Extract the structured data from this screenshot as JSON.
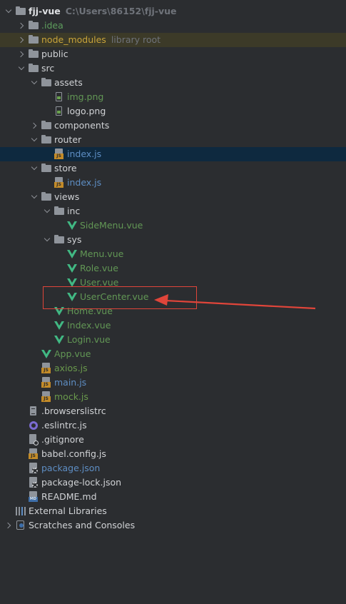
{
  "project": {
    "name": "fjj-vue",
    "path": "C:\\Users\\86152\\fjj-vue"
  },
  "tree": [
    {
      "label": "fjj-vue",
      "hint": "C:\\Users\\86152\\fjj-vue",
      "icon": "folder-icon",
      "depth": 0,
      "arrow": "open",
      "color": "bold"
    },
    {
      "label": ".idea",
      "icon": "folder-icon",
      "depth": 1,
      "arrow": "closed",
      "color": "idea"
    },
    {
      "label": "node_modules",
      "hint": "library root",
      "icon": "folder-icon",
      "depth": 1,
      "arrow": "closed",
      "color": "nm",
      "row": "hl-nm"
    },
    {
      "label": "public",
      "icon": "folder-icon",
      "depth": 1,
      "arrow": "closed",
      "color": "white"
    },
    {
      "label": "src",
      "icon": "folder-icon",
      "depth": 1,
      "arrow": "open",
      "color": "white"
    },
    {
      "label": "assets",
      "icon": "folder-icon",
      "depth": 2,
      "arrow": "open",
      "color": "white"
    },
    {
      "label": "img.png",
      "icon": "image-file-icon",
      "depth": 3,
      "color": "green"
    },
    {
      "label": "logo.png",
      "icon": "image-file-icon",
      "depth": 3,
      "color": "white"
    },
    {
      "label": "components",
      "icon": "folder-icon",
      "depth": 2,
      "arrow": "closed",
      "color": "white"
    },
    {
      "label": "router",
      "icon": "folder-icon",
      "depth": 2,
      "arrow": "open",
      "color": "white"
    },
    {
      "label": "index.js",
      "icon": "js-file-icon",
      "depth": 3,
      "color": "blue",
      "row": "sel"
    },
    {
      "label": "store",
      "icon": "folder-icon",
      "depth": 2,
      "arrow": "open",
      "color": "white"
    },
    {
      "label": "index.js",
      "icon": "js-file-icon",
      "depth": 3,
      "color": "blue"
    },
    {
      "label": "views",
      "icon": "folder-icon",
      "depth": 2,
      "arrow": "open",
      "color": "white"
    },
    {
      "label": "inc",
      "icon": "folder-icon",
      "depth": 3,
      "arrow": "open",
      "color": "white"
    },
    {
      "label": "SideMenu.vue",
      "icon": "vue-file-icon",
      "depth": 4,
      "color": "green"
    },
    {
      "label": "sys",
      "icon": "folder-icon",
      "depth": 3,
      "arrow": "open",
      "color": "white"
    },
    {
      "label": "Menu.vue",
      "icon": "vue-file-icon",
      "depth": 4,
      "color": "green"
    },
    {
      "label": "Role.vue",
      "icon": "vue-file-icon",
      "depth": 4,
      "color": "green"
    },
    {
      "label": "User.vue",
      "icon": "vue-file-icon",
      "depth": 4,
      "color": "green"
    },
    {
      "label": "UserCenter.vue",
      "icon": "vue-file-icon",
      "depth": 4,
      "color": "green"
    },
    {
      "label": "Home.vue",
      "icon": "vue-file-icon",
      "depth": 3,
      "color": "green"
    },
    {
      "label": "Index.vue",
      "icon": "vue-file-icon",
      "depth": 3,
      "color": "green"
    },
    {
      "label": "Login.vue",
      "icon": "vue-file-icon",
      "depth": 3,
      "color": "green"
    },
    {
      "label": "App.vue",
      "icon": "vue-file-icon",
      "depth": 2,
      "color": "green"
    },
    {
      "label": "axios.js",
      "icon": "js-file-icon",
      "depth": 2,
      "color": "js"
    },
    {
      "label": "main.js",
      "icon": "js-file-icon",
      "depth": 2,
      "color": "blue"
    },
    {
      "label": "mock.js",
      "icon": "js-file-icon",
      "depth": 2,
      "color": "js"
    },
    {
      "label": ".browserslistrc",
      "icon": "text-file-icon",
      "depth": 1,
      "color": "white"
    },
    {
      "label": ".eslintrc.js",
      "icon": "eslint-icon",
      "depth": 1,
      "color": "white"
    },
    {
      "label": ".gitignore",
      "icon": "gitignore-icon",
      "depth": 1,
      "color": "white"
    },
    {
      "label": "babel.config.js",
      "icon": "js-file-icon",
      "depth": 1,
      "color": "white"
    },
    {
      "label": "package.json",
      "icon": "json-file-icon",
      "depth": 1,
      "color": "blue"
    },
    {
      "label": "package-lock.json",
      "icon": "json-file-icon",
      "depth": 1,
      "color": "white"
    },
    {
      "label": "README.md",
      "icon": "markdown-file-icon",
      "depth": 1,
      "color": "white"
    },
    {
      "label": "External Libraries",
      "icon": "libraries-icon",
      "depth": 0,
      "color": "white"
    },
    {
      "label": "Scratches and Consoles",
      "icon": "scratches-icon",
      "depth": 0,
      "arrow": "closed",
      "color": "white"
    }
  ],
  "colors": {
    "background": "#2b2d30",
    "selection": "#0e293f",
    "annotation": "#e0453a",
    "vue_icon": "#41b883"
  }
}
